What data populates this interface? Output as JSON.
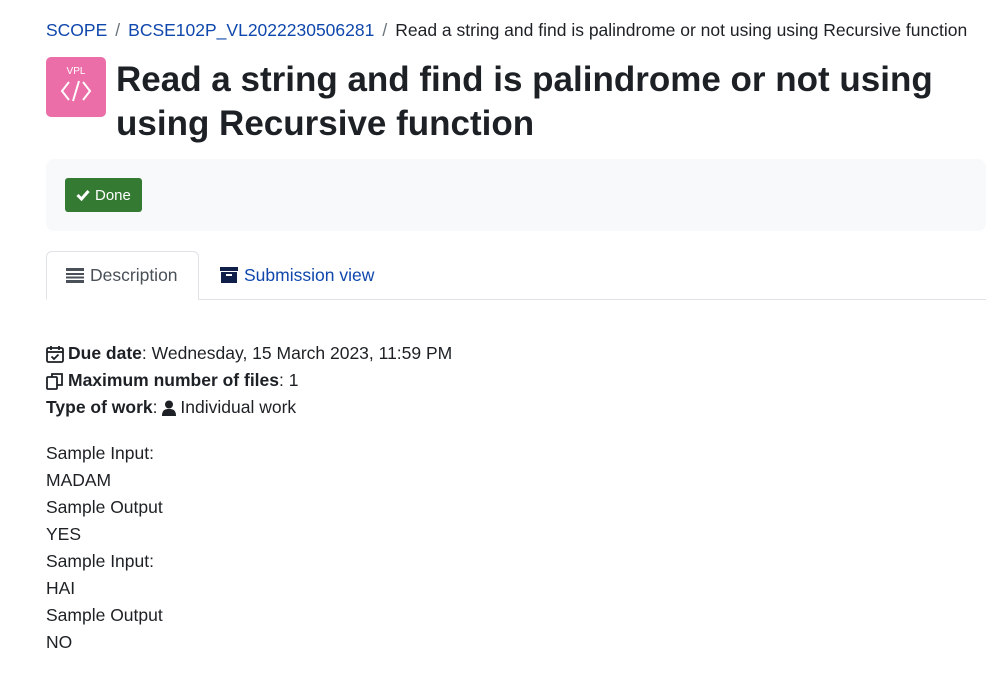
{
  "breadcrumb": {
    "items": [
      "SCOPE",
      "BCSE102P_VL2022230506281"
    ],
    "current": "Read a string and find is palindrome or not using using Recursive function",
    "separator": "/"
  },
  "module_icon": {
    "label": "VPL",
    "color": "#ec6ea8",
    "icon": "code-brackets-icon"
  },
  "page_title": "Read a string and find is palindrome or not using using Recursive function",
  "completion": {
    "done_label": "Done",
    "icon": "check-icon",
    "color": "#357a32"
  },
  "tabs": [
    {
      "label": "Description",
      "icon": "description-icon",
      "active": true
    },
    {
      "label": "Submission view",
      "icon": "archive-icon",
      "active": false
    }
  ],
  "details": {
    "due_date_label": "Due date",
    "due_date_value": "Wednesday, 15 March 2023, 11:59 PM",
    "max_files_label": "Maximum number of files",
    "max_files_value": "1",
    "work_type_label": "Type of work",
    "work_type_value": "Individual work",
    "separator": ":"
  },
  "sample_lines": [
    "Sample Input:",
    "MADAM",
    "Sample Output",
    "YES",
    "Sample Input:",
    "HAI",
    "Sample Output",
    "NO"
  ]
}
